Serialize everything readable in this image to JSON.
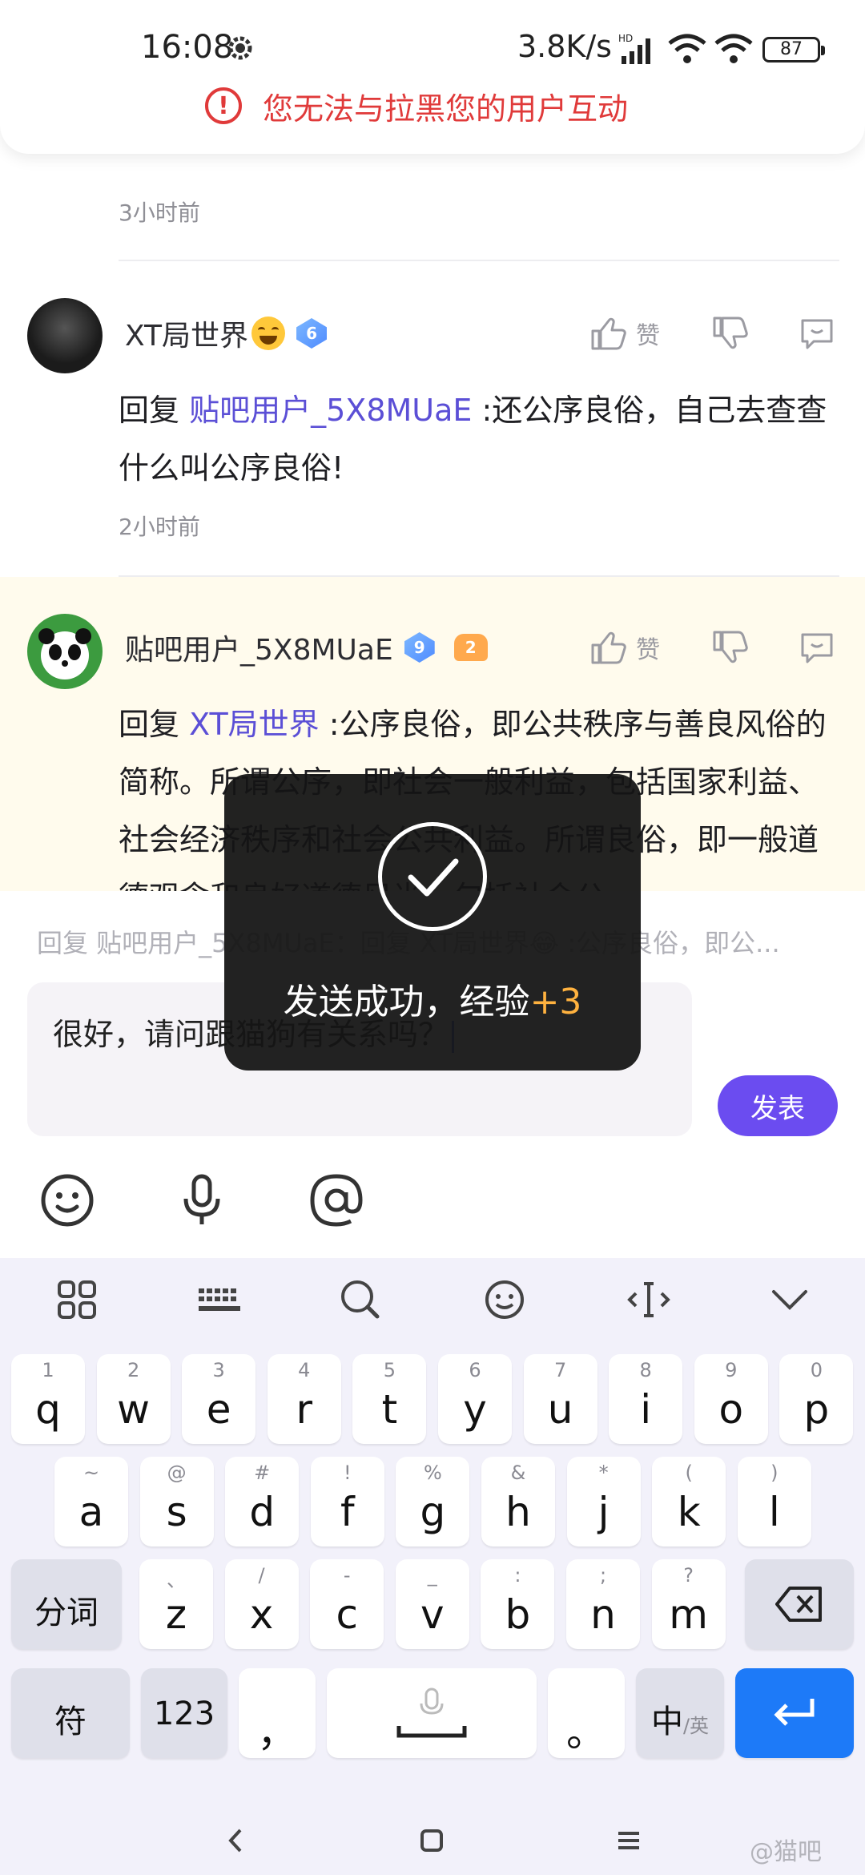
{
  "status_bar": {
    "time": "16:08",
    "net_speed": "3.8K/s",
    "signal_label": "HD",
    "battery": "87"
  },
  "banner": {
    "warning": "您无法与拉黑您的用户互动"
  },
  "feed": {
    "prev_time": "3小时前",
    "comments": [
      {
        "user": "XT局世界",
        "level": "6",
        "reply_prefix": "回复",
        "mention": "贴吧用户_5X8MUaE",
        "text": " :还公序良俗，自己去查查什么叫公序良俗!",
        "time": "2小时前",
        "like_label": "赞"
      },
      {
        "user": "贴吧用户_5X8MUaE",
        "level": "9",
        "badge": "2",
        "reply_prefix": "回复",
        "mention": "XT局世界",
        "text": " :公序良俗，即公共秩序与善良风俗的简称。所谓公序，即社会一般利益，包括国家利益、社会经济秩序和社会公共利益。所谓良俗，即一般道德观念和良好道德风尚，包括社会公",
        "like_label": "赞"
      }
    ]
  },
  "composer": {
    "reply_to": "回复 贴吧用户_5X8MUaE：回复 XT局世界😂 :公序良俗，即公...",
    "input_value": "很好，请问跟猫狗有关系吗？",
    "send_label": "发表"
  },
  "keyboard": {
    "row1": [
      {
        "k": "q",
        "h": "1"
      },
      {
        "k": "w",
        "h": "2"
      },
      {
        "k": "e",
        "h": "3"
      },
      {
        "k": "r",
        "h": "4"
      },
      {
        "k": "t",
        "h": "5"
      },
      {
        "k": "y",
        "h": "6"
      },
      {
        "k": "u",
        "h": "7"
      },
      {
        "k": "i",
        "h": "8"
      },
      {
        "k": "o",
        "h": "9"
      },
      {
        "k": "p",
        "h": "0"
      }
    ],
    "row2": [
      {
        "k": "a",
        "h": "~"
      },
      {
        "k": "s",
        "h": "@"
      },
      {
        "k": "d",
        "h": "#"
      },
      {
        "k": "f",
        "h": "!"
      },
      {
        "k": "g",
        "h": "%"
      },
      {
        "k": "h",
        "h": "&"
      },
      {
        "k": "j",
        "h": "*"
      },
      {
        "k": "k",
        "h": "("
      },
      {
        "k": "l",
        "h": ")"
      }
    ],
    "row3": [
      {
        "k": "z",
        "h": "、"
      },
      {
        "k": "x",
        "h": "/"
      },
      {
        "k": "c",
        "h": "-"
      },
      {
        "k": "v",
        "h": "_"
      },
      {
        "k": "b",
        "h": ":"
      },
      {
        "k": "n",
        "h": ";"
      },
      {
        "k": "m",
        "h": "?"
      }
    ],
    "segment_label": "分词",
    "symbol_label": "符",
    "num_label": "123",
    "comma_label": "，",
    "period_label": "。",
    "lang_label": "中",
    "lang_sub": "/英"
  },
  "toast": {
    "message": "发送成功，经验",
    "exp": "+3"
  },
  "watermark": "@猫吧"
}
